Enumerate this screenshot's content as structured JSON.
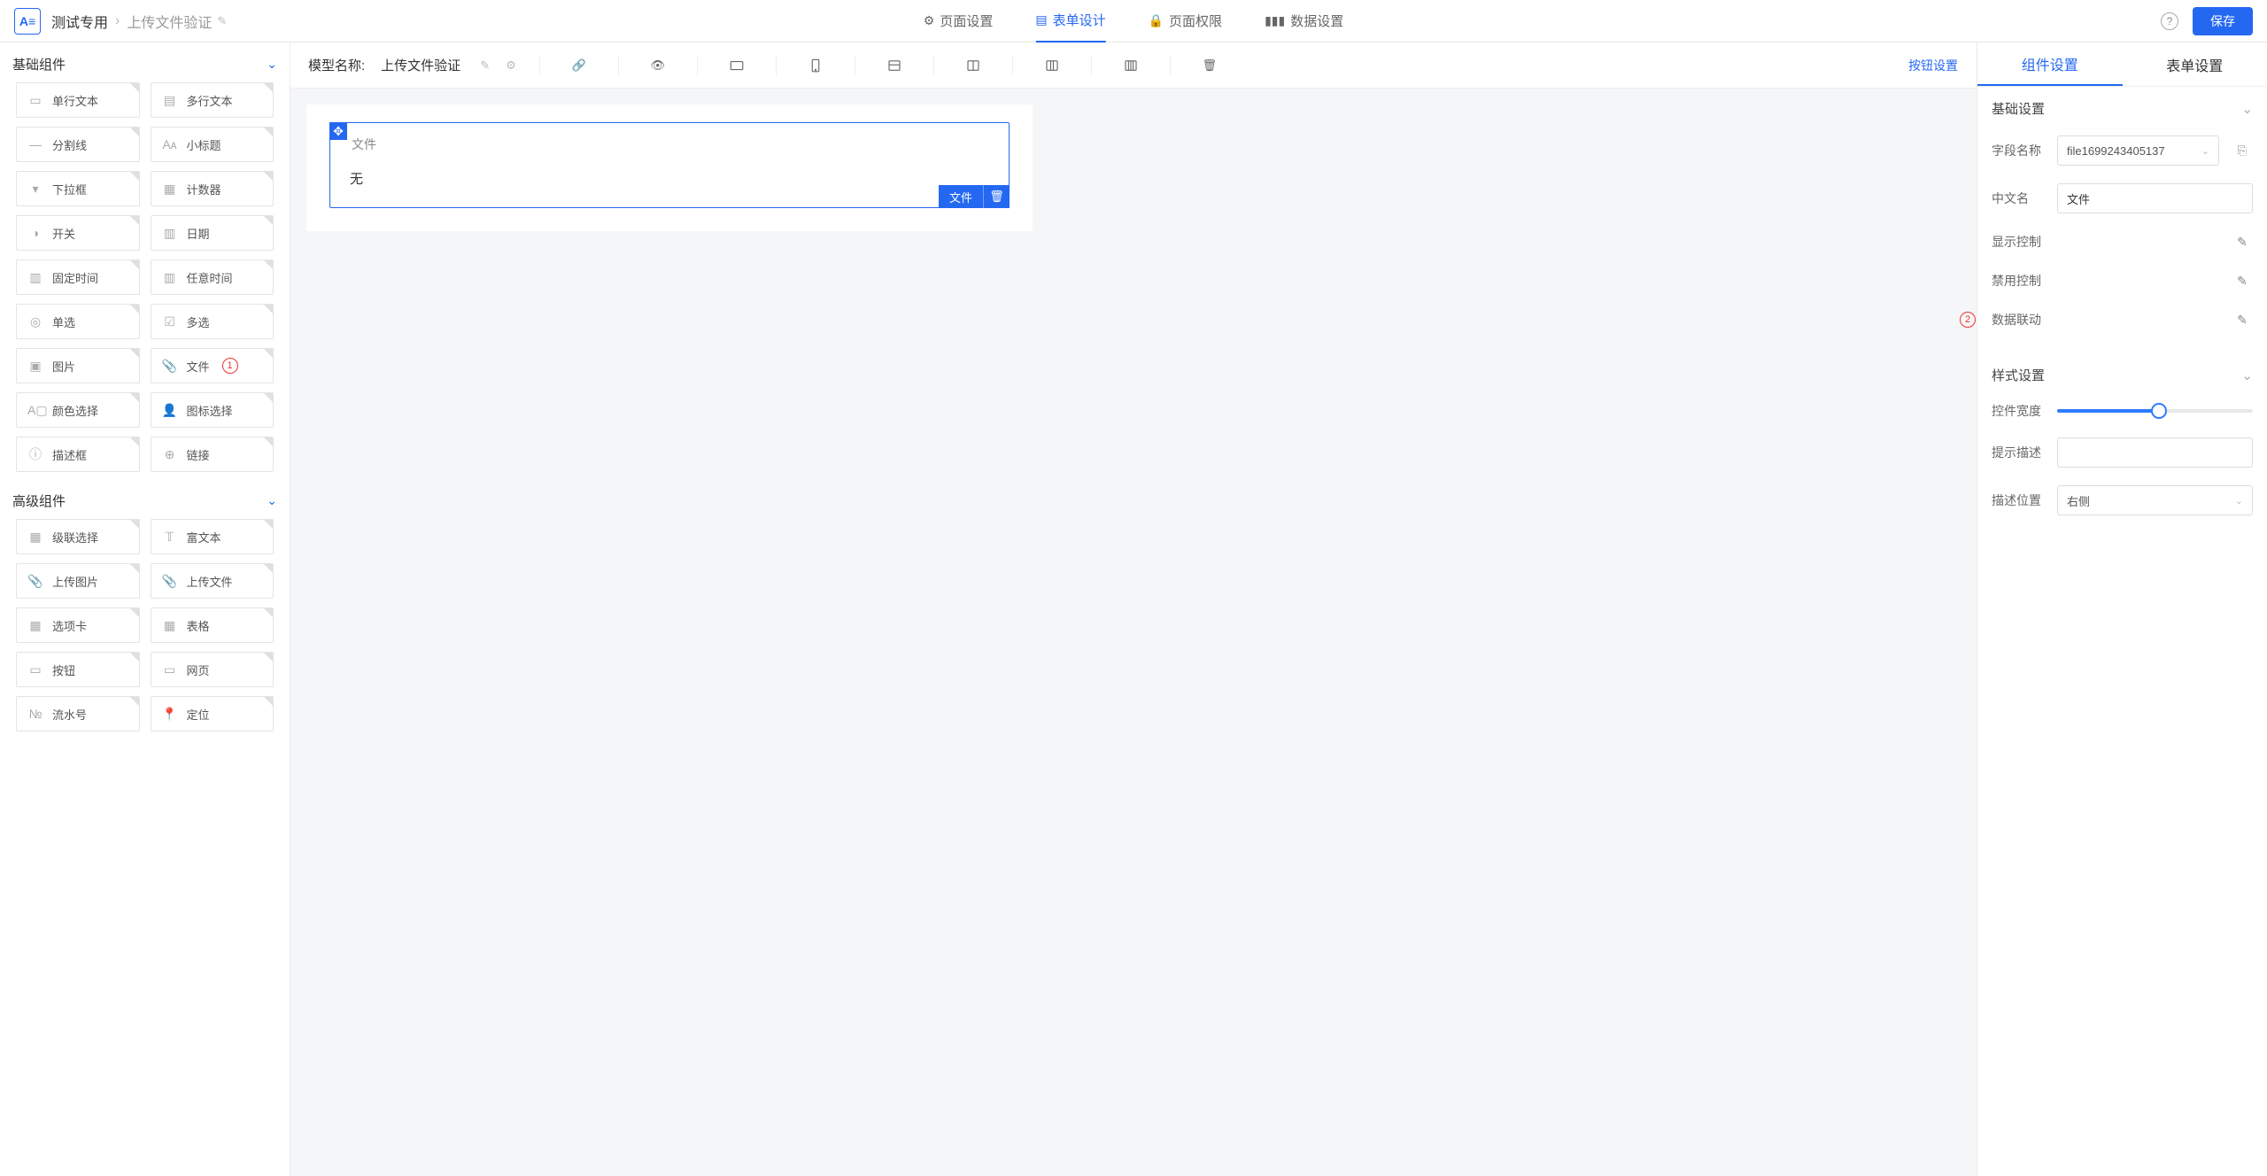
{
  "header": {
    "breadcrumb_root": "测试专用",
    "breadcrumb_current": "上传文件验证",
    "tabs": [
      {
        "label": "页面设置",
        "active": false
      },
      {
        "label": "表单设计",
        "active": true
      },
      {
        "label": "页面权限",
        "active": false
      },
      {
        "label": "数据设置",
        "active": false
      }
    ],
    "save": "保存"
  },
  "palette": {
    "groups": [
      {
        "title": "基础组件",
        "items": [
          {
            "label": "单行文本"
          },
          {
            "label": "多行文本"
          },
          {
            "label": "分割线"
          },
          {
            "label": "小标题"
          },
          {
            "label": "下拉框"
          },
          {
            "label": "计数器"
          },
          {
            "label": "开关"
          },
          {
            "label": "日期"
          },
          {
            "label": "固定时间"
          },
          {
            "label": "任意时间"
          },
          {
            "label": "单选"
          },
          {
            "label": "多选"
          },
          {
            "label": "图片"
          },
          {
            "label": "文件",
            "badge": "1"
          },
          {
            "label": "颜色选择"
          },
          {
            "label": "图标选择"
          },
          {
            "label": "描述框"
          },
          {
            "label": "链接"
          }
        ]
      },
      {
        "title": "高级组件",
        "items": [
          {
            "label": "级联选择"
          },
          {
            "label": "富文本"
          },
          {
            "label": "上传图片"
          },
          {
            "label": "上传文件"
          },
          {
            "label": "选项卡"
          },
          {
            "label": "表格"
          },
          {
            "label": "按钮"
          },
          {
            "label": "网页"
          },
          {
            "label": "流水号"
          },
          {
            "label": "定位"
          }
        ]
      }
    ]
  },
  "canvas": {
    "model_label": "模型名称:",
    "model_name": "上传文件验证",
    "btn_settings": "按钮设置",
    "selected": {
      "label": "文件",
      "value": "无",
      "tag": "文件"
    }
  },
  "rightPanel": {
    "tabs": {
      "component": "组件设置",
      "form": "表单设置"
    },
    "basic": {
      "title": "基础设置",
      "fieldName_label": "字段名称",
      "fieldName_value": "file1699243405137",
      "cnName_label": "中文名",
      "cnName_value": "文件",
      "displayCtrl_label": "显示控制",
      "disableCtrl_label": "禁用控制",
      "dataLink_label": "数据联动",
      "dataLink_badge": "2"
    },
    "style": {
      "title": "样式设置",
      "width_label": "控件宽度",
      "width_percent": 52,
      "hint_label": "提示描述",
      "hint_value": "",
      "descPos_label": "描述位置",
      "descPos_value": "右侧"
    }
  }
}
